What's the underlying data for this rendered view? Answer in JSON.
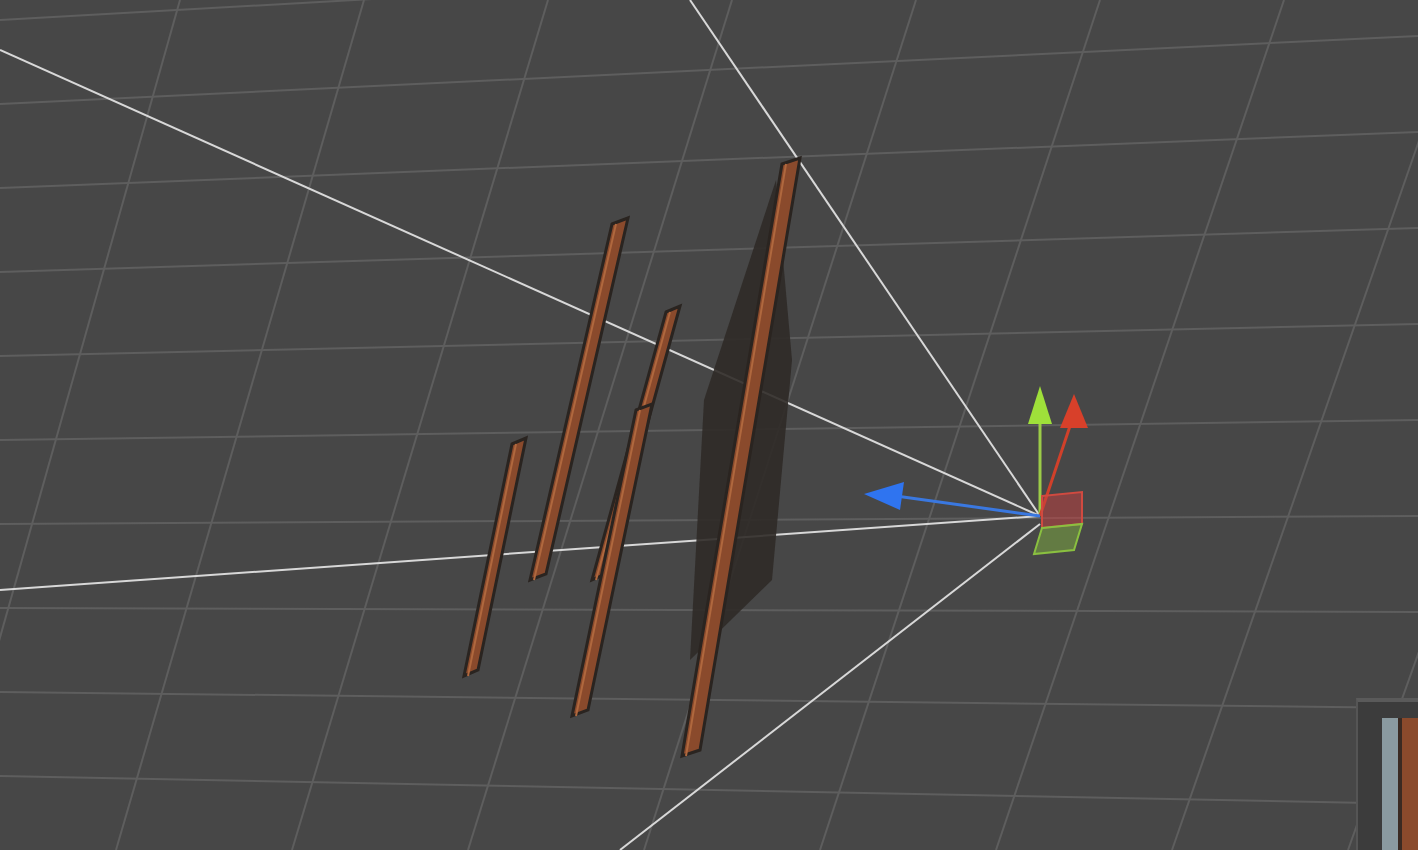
{
  "scene_view": {
    "camera_preview": true
  }
}
